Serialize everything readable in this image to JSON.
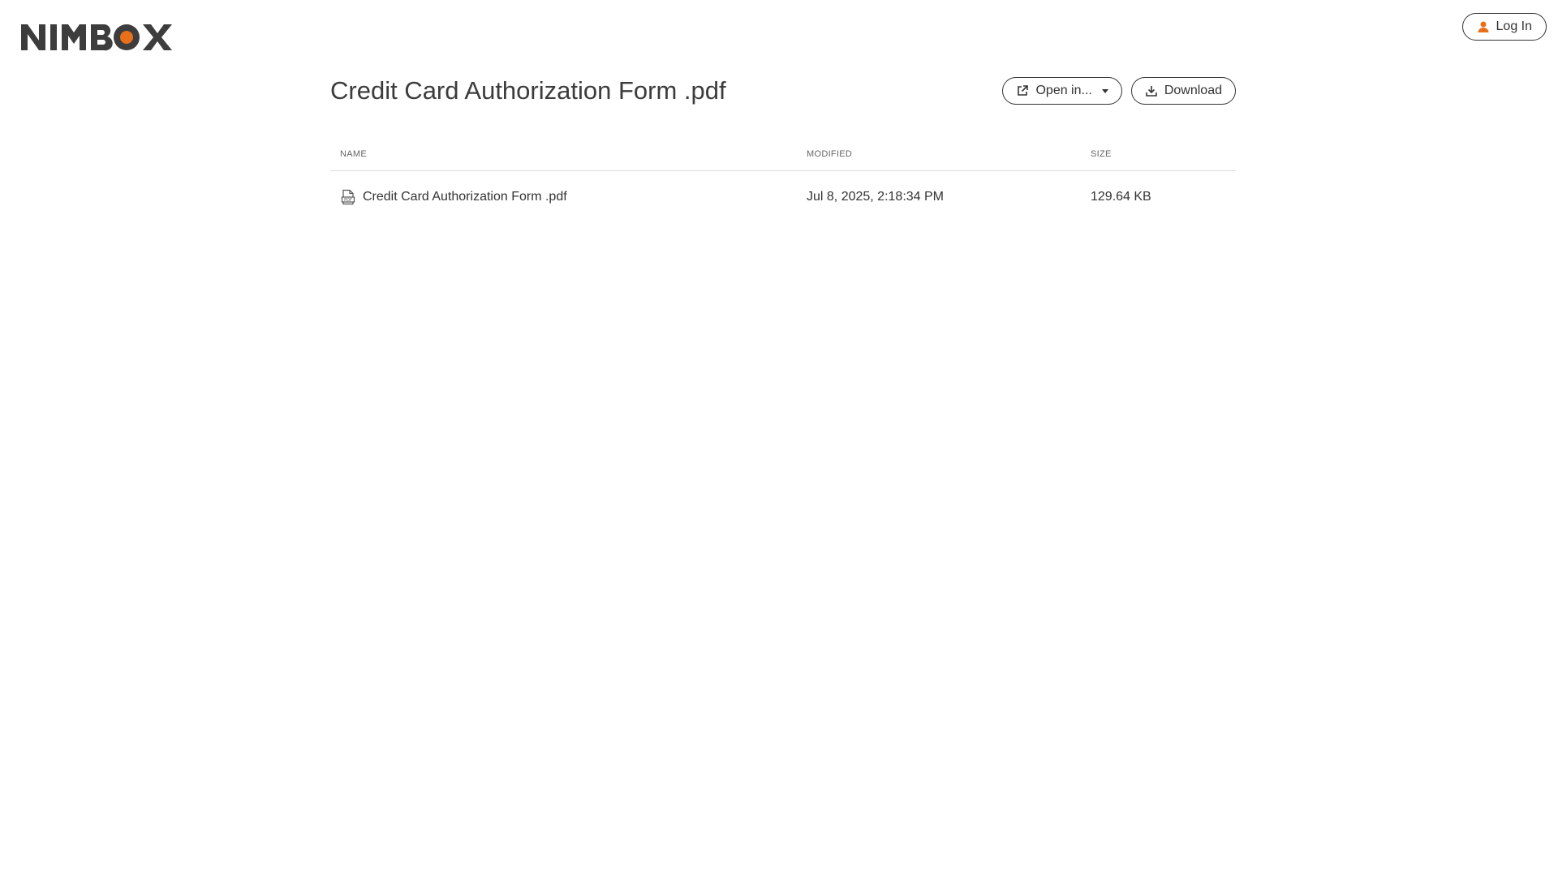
{
  "header": {
    "logo_text": "NIMBOX",
    "login_label": "Log In",
    "login_icon": "user-icon",
    "accent": "#e8701a"
  },
  "file": {
    "title": "Credit Card Authorization Form .pdf",
    "open_in_label": "Open in...",
    "open_in_icon": "external-link-icon",
    "download_label": "Download",
    "download_icon": "download-icon"
  },
  "table": {
    "columns": [
      "NAME",
      "MODIFIED",
      "SIZE"
    ],
    "rows": [
      {
        "icon": "pdf-file-icon",
        "name": "Credit Card Authorization Form .pdf",
        "modified": "Jul 8, 2025, 2:18:34 PM",
        "size": "129.64 KB"
      }
    ]
  }
}
